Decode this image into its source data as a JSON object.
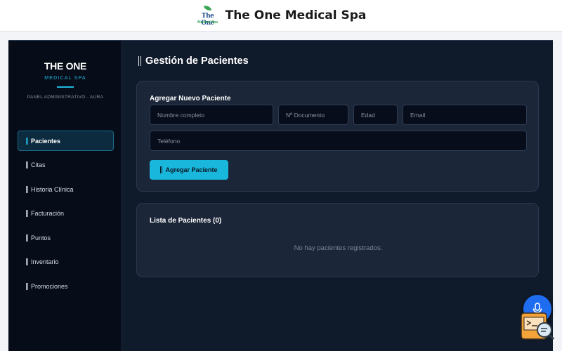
{
  "header": {
    "logo_word": "The One",
    "logo_sub": "Medical Spa",
    "title": "The One Medical Spa"
  },
  "sidebar": {
    "brand_title": "THE ONE",
    "brand_sub": "MEDICAL SPA",
    "panel_label": "PANEL ADMINISTRATIVO · AURA",
    "items": [
      {
        "label": "Pacientes",
        "active": true
      },
      {
        "label": "Citas"
      },
      {
        "label": "Historia Clínica"
      },
      {
        "label": "Facturación"
      },
      {
        "label": "Puntos"
      },
      {
        "label": "Inventario"
      },
      {
        "label": "Promociones"
      }
    ]
  },
  "main": {
    "page_title": "Gestión de Pacientes",
    "form": {
      "heading": "Agregar Nuevo Paciente",
      "fields": {
        "name": {
          "placeholder": "Nombre completo"
        },
        "document": {
          "placeholder": "Nº Documento"
        },
        "age": {
          "placeholder": "Edad"
        },
        "email": {
          "placeholder": "Email"
        },
        "phone": {
          "placeholder": "Teléfono"
        }
      },
      "submit_label": "Agregar Paciente"
    },
    "list": {
      "heading": "Lista de Pacientes (0)",
      "empty_text": "No hay pacientes registrados."
    }
  },
  "colors": {
    "accent": "#19b7db",
    "fab": "#1e6cf0",
    "sidebar_bg": "#060c18",
    "card_bg": "#1b2638"
  },
  "icons": {
    "fab": "microphone-icon",
    "helper": "chat-search-icon"
  }
}
